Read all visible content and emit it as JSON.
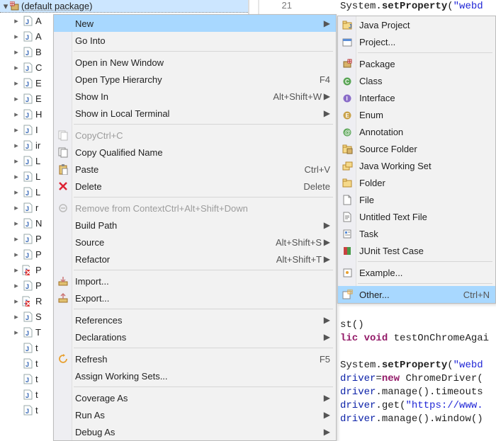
{
  "tree": {
    "root_label": "(default package)",
    "items": [
      {
        "label": "A"
      },
      {
        "label": "A"
      },
      {
        "label": "B"
      },
      {
        "label": "C"
      },
      {
        "label": "E"
      },
      {
        "label": "E"
      },
      {
        "label": "H"
      },
      {
        "label": "I"
      },
      {
        "label": "ir"
      },
      {
        "label": "L"
      },
      {
        "label": "L"
      },
      {
        "label": "L"
      },
      {
        "label": "r"
      },
      {
        "label": "N"
      },
      {
        "label": "P"
      },
      {
        "label": "P"
      },
      {
        "label": "P",
        "red": true
      },
      {
        "label": "P"
      },
      {
        "label": "R",
        "red": true
      },
      {
        "label": "S"
      },
      {
        "label": "T"
      },
      {
        "label": "t",
        "leaf": true
      },
      {
        "label": "t",
        "leaf": true
      },
      {
        "label": "t",
        "leaf": true
      },
      {
        "label": "t",
        "leaf": true
      },
      {
        "label": "t",
        "leaf": true
      }
    ]
  },
  "gutter": {
    "line": "21"
  },
  "code_top": {
    "l1_a": "System.",
    "l1_b": "setProperty",
    "l1_c": "(",
    "l1_d": "\"webd"
  },
  "code_bottom": {
    "l1": "st()",
    "l2_a": "lic",
    "l2_b": " void",
    "l2_c": " testOnChromeAgai",
    "l4_a": "System.",
    "l4_b": "setProperty",
    "l4_c": "(",
    "l4_d": "\"webd",
    "l5_a": "driver",
    "l5_b": "=",
    "l5_c": "new",
    "l5_d": " ChromeDriver(",
    "l6_a": "driver",
    "l6_b": ".manage().timeouts",
    "l7_a": "driver",
    "l7_b": ".get(",
    "l7_c": "\"https://www.",
    "l8_a": "driver",
    "l8_b": ".manage().window()"
  },
  "menu1": {
    "new": "New",
    "go_into": "Go Into",
    "open_new_window": "Open in New Window",
    "open_type_hierarchy": "Open Type Hierarchy",
    "open_type_hierarchy_acc": "F4",
    "show_in": "Show In",
    "show_in_acc": "Alt+Shift+W",
    "show_in_local_terminal": "Show in Local Terminal",
    "copy": "Copy",
    "copy_acc": "Ctrl+C",
    "copy_qualified": "Copy Qualified Name",
    "paste": "Paste",
    "paste_acc": "Ctrl+V",
    "delete": "Delete",
    "delete_acc": "Delete",
    "remove_from_context": "Remove from Context",
    "remove_from_context_acc": "Ctrl+Alt+Shift+Down",
    "build_path": "Build Path",
    "source": "Source",
    "source_acc": "Alt+Shift+S",
    "refactor": "Refactor",
    "refactor_acc": "Alt+Shift+T",
    "import": "Import...",
    "export": "Export...",
    "references": "References",
    "declarations": "Declarations",
    "refresh": "Refresh",
    "refresh_acc": "F5",
    "assign_ws": "Assign Working Sets...",
    "coverage_as": "Coverage As",
    "run_as": "Run As",
    "debug_as": "Debug As"
  },
  "menu2": {
    "java_project": "Java Project",
    "project": "Project...",
    "package": "Package",
    "class": "Class",
    "interface": "Interface",
    "enum": "Enum",
    "annotation": "Annotation",
    "source_folder": "Source Folder",
    "java_working_set": "Java Working Set",
    "folder": "Folder",
    "file": "File",
    "untitled_text": "Untitled Text File",
    "task": "Task",
    "junit": "JUnit Test Case",
    "example": "Example...",
    "other": "Other...",
    "other_acc": "Ctrl+N"
  }
}
